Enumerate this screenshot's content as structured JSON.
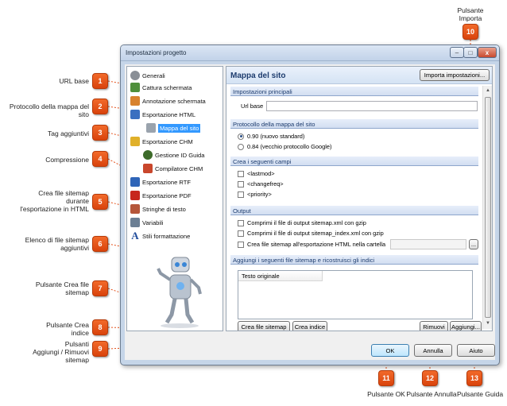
{
  "callouts": {
    "url_base": "URL base",
    "protocollo": "Protocollo della mappa del sito",
    "tag": "Tag aggiuntivi",
    "compressione": "Compressione",
    "crea_file_l1": "Crea file sitemap",
    "crea_file_l2": "durante",
    "crea_file_l3": "l'esportazione in HTML",
    "elenco_l1": "Elenco di file sitemap",
    "elenco_l2": "aggiuntivi",
    "pulsante_crea_l1": "Pulsante Crea file",
    "pulsante_crea_l2": "sitemap",
    "pulsante_indice_l1": "Pulsante Crea",
    "pulsante_indice_l2": "indice",
    "aggiungi_l1": "Pulsanti",
    "aggiungi_l2": "Aggiungi / Rimuovi",
    "aggiungi_l3": "sitemap",
    "importa_l1": "Pulsante",
    "importa_l2": "Importa",
    "ok": "Pulsante OK",
    "annulla": "Pulsante Annulla",
    "guida": "Pulsante Guida"
  },
  "badges": [
    "1",
    "2",
    "3",
    "4",
    "5",
    "6",
    "7",
    "8",
    "9",
    "10",
    "11",
    "12",
    "13"
  ],
  "window": {
    "title": "Impostazioni progetto",
    "controls": [
      "–",
      "□",
      "x"
    ]
  },
  "tree": {
    "items": [
      {
        "label": "Generali",
        "icon": "gear-icon",
        "color": "#8a8f96"
      },
      {
        "label": "Cattura schermata",
        "icon": "screen-capture-icon",
        "color": "#4f8f3b"
      },
      {
        "label": "Annotazione schermata",
        "icon": "annotation-icon",
        "color": "#d8822e"
      },
      {
        "label": "Esportazione HTML",
        "icon": "html-export-icon",
        "color": "#3a6fc0"
      },
      {
        "label": "Mappa del sito",
        "icon": "sitemap-icon",
        "color": "#9aa3ad",
        "selected": true
      },
      {
        "label": "Esportazione CHM",
        "icon": "chm-export-icon",
        "color": "#e0b02a"
      },
      {
        "label": "Gestione ID Guida",
        "icon": "id-icon",
        "color": "#3d6b2a"
      },
      {
        "label": "Compilatore CHM",
        "icon": "compiler-icon",
        "color": "#c9472c"
      },
      {
        "label": "Esportazione RTF",
        "icon": "rtf-export-icon",
        "color": "#2f65b8"
      },
      {
        "label": "Esportazione PDF",
        "icon": "pdf-export-icon",
        "color": "#c7271d"
      },
      {
        "label": "Stringhe di testo",
        "icon": "text-strings-icon",
        "color": "#b5563a"
      },
      {
        "label": "Variabili",
        "icon": "variables-icon",
        "color": "#6c7f94"
      },
      {
        "label": "Stili formattazione",
        "icon": "styles-icon",
        "color": "#1e4a9a"
      }
    ]
  },
  "panel": {
    "title": "Mappa del sito",
    "import_button": "Importa impostazioni...",
    "sections": {
      "main": "Impostazioni principali",
      "protocol": "Protocollo della mappa del sito",
      "fields": "Crea i seguenti campi",
      "output": "Output",
      "additional": "Aggiungi i seguenti file sitemap e ricostruisci gli indici"
    },
    "url_base_label": "Url base",
    "url_base_value": "",
    "protocol_options": [
      {
        "label": "0.90 (nuovo standard)",
        "selected": true
      },
      {
        "label": "0.84 (vecchio protocollo Google)",
        "selected": false
      }
    ],
    "field_options": [
      "<lastmod>",
      "<changefreq>",
      "<priority>"
    ],
    "output_options": [
      "Comprimi il file di output sitemap.xml con gzip",
      "Comprimi il file di output sitemap_index.xml con gzip",
      "Crea file sitemap all'esportazione HTML nella cartella"
    ],
    "output_folder_value": "",
    "browse_button": "...",
    "grid_header": "Testo originale",
    "buttons": {
      "create_sitemap": "Crea file sitemap",
      "create_index": "Crea indice",
      "remove": "Rimuovi",
      "add": "Aggiungi..."
    }
  },
  "dialog_buttons": {
    "ok": "OK",
    "cancel": "Annulla",
    "help": "Aiuto"
  },
  "colors": {
    "badge": "#e8581a",
    "leader": "#e4521c",
    "section_text": "#1d3c6e"
  }
}
